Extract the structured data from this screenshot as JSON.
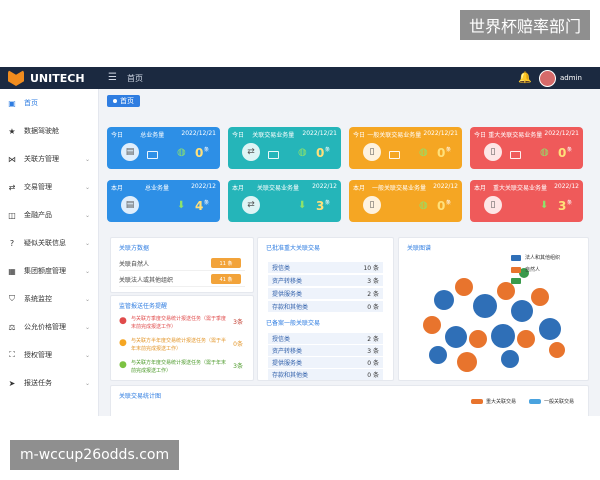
{
  "watermarks": {
    "top": "世界杯赔率部门",
    "bottom": "m-wccup26odds.com"
  },
  "header": {
    "app_name": "UNITECH",
    "breadcrumb": "首页",
    "user": "admin"
  },
  "sidebar": {
    "items": [
      {
        "label": "首页",
        "icon": "monitor-icon"
      },
      {
        "label": "数据驾驶舱",
        "icon": "star-icon"
      },
      {
        "label": "关联方管理",
        "icon": "share-icon"
      },
      {
        "label": "交易管理",
        "icon": "exchange-icon"
      },
      {
        "label": "金融产品",
        "icon": "layers-icon"
      },
      {
        "label": "疑似关联信息",
        "icon": "question-icon"
      },
      {
        "label": "集团额度管理",
        "icon": "building-icon"
      },
      {
        "label": "系统监控",
        "icon": "shield-icon"
      },
      {
        "label": "公允价格管理",
        "icon": "price-icon"
      },
      {
        "label": "授权管理",
        "icon": "org-icon"
      },
      {
        "label": "报送任务",
        "icon": "send-icon"
      }
    ]
  },
  "tab": {
    "label": "首页"
  },
  "cards": [
    {
      "period": "今日",
      "name": "总业务量",
      "date": "2022/12/21",
      "value": "0",
      "unit": "条",
      "color": "#2d8fe6"
    },
    {
      "period": "今日",
      "name": "关联交易业务量",
      "date": "2022/12/21",
      "value": "0",
      "unit": "条",
      "color": "#25b5b9"
    },
    {
      "period": "今日",
      "name": "一般关联交易业务量",
      "date": "2022/12/21",
      "value": "0",
      "unit": "条",
      "color": "#f5a623"
    },
    {
      "period": "今日",
      "name": "重大关联交易业务量",
      "date": "2022/12/21",
      "value": "0",
      "unit": "条",
      "color": "#ef5a5a"
    },
    {
      "period": "本月",
      "name": "总业务量",
      "date": "2022/12",
      "value": "4",
      "unit": "条",
      "color": "#2d8fe6"
    },
    {
      "period": "本月",
      "name": "关联交易业务量",
      "date": "2022/12",
      "value": "3",
      "unit": "条",
      "color": "#25b5b9"
    },
    {
      "period": "本月",
      "name": "一般关联交易业务量",
      "date": "2022/12",
      "value": "0",
      "unit": "条",
      "color": "#f5a623"
    },
    {
      "period": "本月",
      "name": "重大关联交易业务量",
      "date": "2022/12",
      "value": "3",
      "unit": "条",
      "color": "#ef5a5a"
    }
  ],
  "related_party": {
    "title": "关联方数据",
    "rows": [
      {
        "label": "关联自然人",
        "value": "11 条"
      },
      {
        "label": "关联法人或其他组织",
        "value": "41 条"
      }
    ]
  },
  "tasks": {
    "title": "监管报送任务提醒",
    "items": [
      {
        "text": "与关联方季度交易统计报送任务（需于季度末前完成报送工作）",
        "count": "3条",
        "color": "#e04b4b"
      },
      {
        "text": "与关联方半年度交易统计报送任务（需于半年末前完成报送工作）",
        "count": "0条",
        "color": "#f5a623"
      },
      {
        "text": "与关联方年度交易统计报送任务（需于年末前完成报送工作）",
        "count": "3条",
        "color": "#7cc242"
      }
    ]
  },
  "approval": {
    "pending_title": "已批准重大关联交易",
    "pending_rows": [
      {
        "label": "授信类",
        "value": "10 条"
      },
      {
        "label": "资产转移类",
        "value": "3 条"
      },
      {
        "label": "提供服务类",
        "value": "2 条"
      },
      {
        "label": "存款和其他类",
        "value": "0 条"
      }
    ],
    "filed_title": "已备案一般关联交易",
    "filed_rows": [
      {
        "label": "授信类",
        "value": "2 条"
      },
      {
        "label": "资产转移类",
        "value": "3 条"
      },
      {
        "label": "提供服务类",
        "value": "0 条"
      },
      {
        "label": "存款和其他类",
        "value": "0 条"
      }
    ]
  },
  "graph": {
    "title": "关联图谱",
    "legend": [
      {
        "label": "法人和其他组织",
        "color": "#2f6fb7"
      },
      {
        "label": "自然人",
        "color": "#e8742d"
      },
      {
        "label": "",
        "color": "#3a9a4b"
      }
    ]
  },
  "stats": {
    "title": "关联交易统计图",
    "legend": [
      {
        "label": "重大关联交易",
        "color": "#e8742d"
      },
      {
        "label": "一般关联交易",
        "color": "#4aa3df"
      }
    ]
  }
}
